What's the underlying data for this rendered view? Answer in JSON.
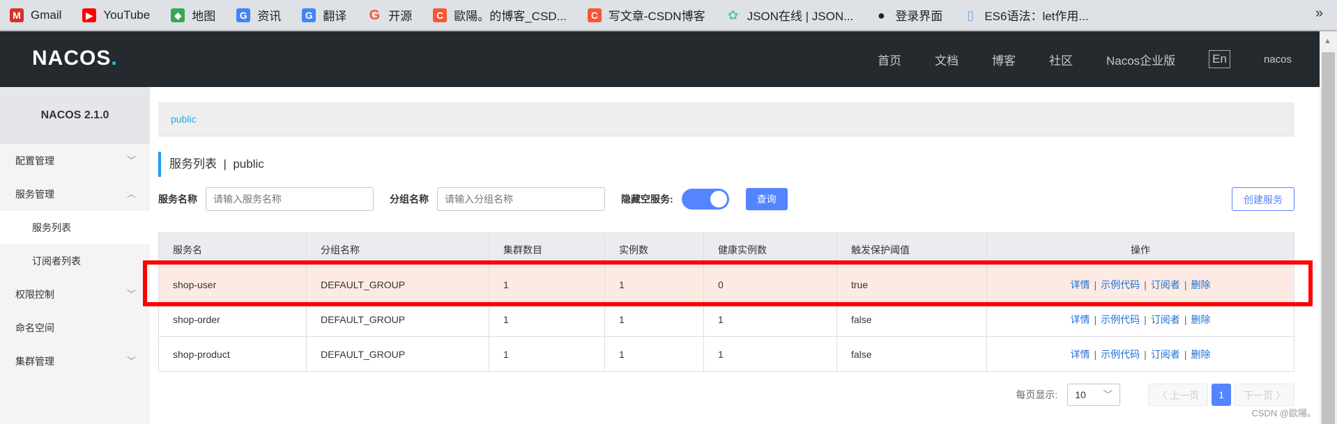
{
  "bookmarks": [
    {
      "label": "Gmail",
      "icon": "gmail-icon",
      "color": "#d93025",
      "glyph": "M"
    },
    {
      "label": "YouTube",
      "icon": "youtube-icon",
      "color": "#ff0000",
      "glyph": "▶"
    },
    {
      "label": "地图",
      "icon": "maps-icon",
      "color": "#34a853",
      "glyph": "◆"
    },
    {
      "label": "资讯",
      "icon": "news-icon",
      "color": "#4285f4",
      "glyph": "G"
    },
    {
      "label": "翻译",
      "icon": "translate-icon",
      "color": "#4285f4",
      "glyph": "G"
    },
    {
      "label": "开源",
      "icon": "gitee-icon",
      "color": "#fff",
      "glyph": "G"
    },
    {
      "label": "歐陽。的博客_CSD...",
      "icon": "csdn-icon",
      "color": "#fc5531",
      "glyph": "C"
    },
    {
      "label": "写文章-CSDN博客",
      "icon": "csdn-icon",
      "color": "#fc5531",
      "glyph": "C"
    },
    {
      "label": "JSON在线 | JSON...",
      "icon": "json-icon",
      "color": "#5fc4b6",
      "glyph": "✿"
    },
    {
      "label": "登录界面",
      "icon": "globe-icon",
      "color": "#222",
      "glyph": "●"
    },
    {
      "label": "ES6语法：let作用...",
      "icon": "doc-icon",
      "color": "#7aa8d8",
      "glyph": "▯"
    }
  ],
  "bookmarks_more": "»",
  "header": {
    "logo": "NACOS",
    "logo_dot": ".",
    "nav": [
      "首页",
      "文档",
      "博客",
      "社区",
      "Nacos企业版"
    ],
    "lang": "En",
    "user": "nacos"
  },
  "sidebar": {
    "version": "NACOS 2.1.0",
    "items": [
      {
        "label": "配置管理",
        "chevron": "﹀"
      },
      {
        "label": "服务管理",
        "chevron": "︿"
      },
      {
        "label": "服务列表",
        "sub": true
      },
      {
        "label": "订阅者列表",
        "sub": true
      },
      {
        "label": "权限控制",
        "chevron": "﹀"
      },
      {
        "label": "命名空间"
      },
      {
        "label": "集群管理",
        "chevron": "﹀"
      }
    ]
  },
  "main": {
    "breadcrumb": "public",
    "title": "服务列表",
    "title_sep": "|",
    "namespace": "public",
    "search": {
      "service_label": "服务名称",
      "service_placeholder": "请输入服务名称",
      "group_label": "分组名称",
      "group_placeholder": "请输入分组名称",
      "hide_empty_label": "隐藏空服务:",
      "hide_empty": true,
      "query": "查询",
      "create": "创建服务"
    },
    "table": {
      "headers": [
        "服务名",
        "分组名称",
        "集群数目",
        "实例数",
        "健康实例数",
        "触发保护阈值",
        "操作"
      ],
      "rows": [
        [
          "shop-user",
          "DEFAULT_GROUP",
          "1",
          "1",
          "0",
          "true"
        ],
        [
          "shop-order",
          "DEFAULT_GROUP",
          "1",
          "1",
          "1",
          "false"
        ],
        [
          "shop-product",
          "DEFAULT_GROUP",
          "1",
          "1",
          "1",
          "false"
        ]
      ],
      "ops": [
        "详情",
        "示例代码",
        "订阅者",
        "删除"
      ],
      "op_sep": "|"
    },
    "pagination": {
      "per_page_label": "每页显示:",
      "per_page": "10",
      "prev": "〈 上一页",
      "current": "1",
      "next": "下一页 〉"
    }
  },
  "watermark": "CSDN @歐陽。"
}
